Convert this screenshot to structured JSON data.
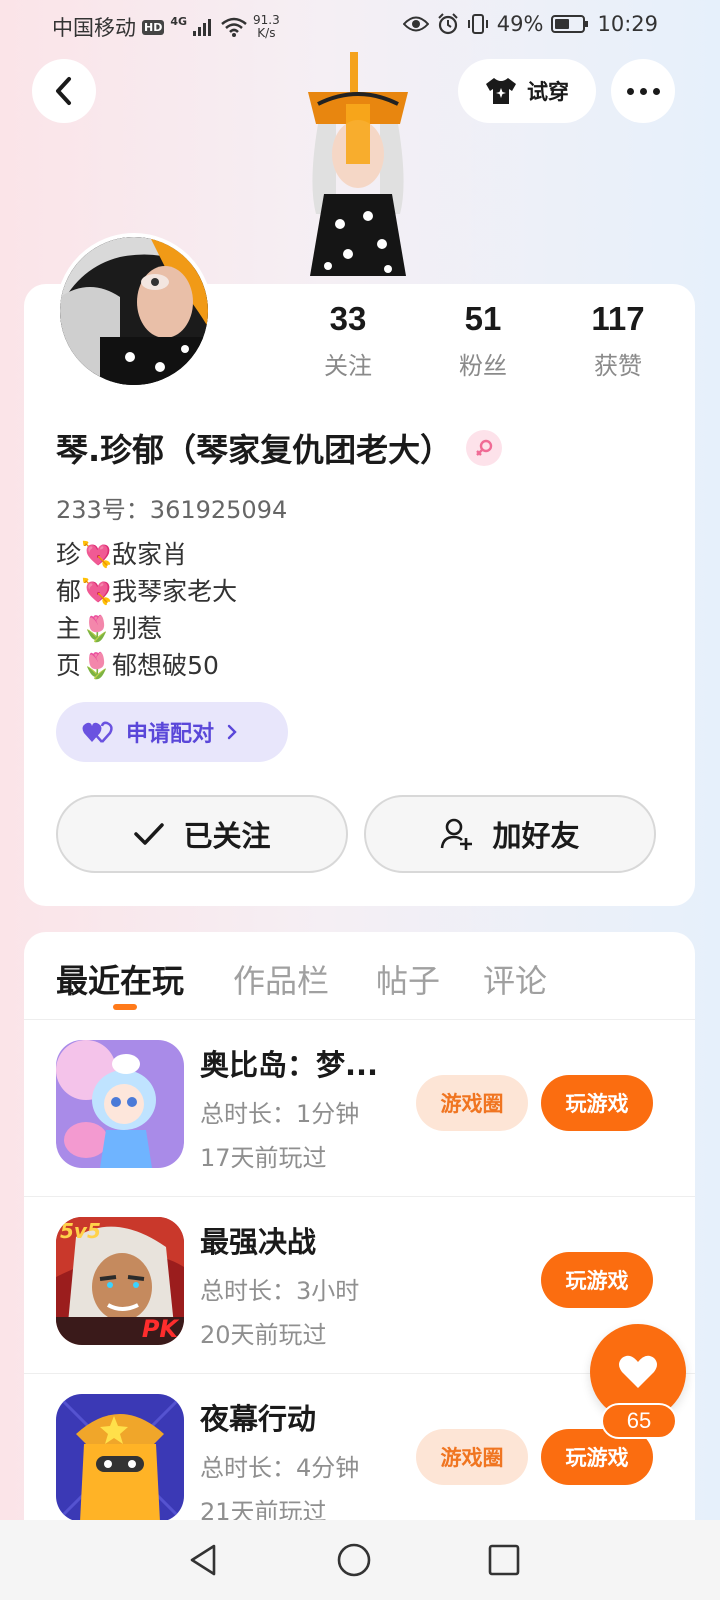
{
  "status_bar": {
    "carrier": "中国移动",
    "hd_badge": "HD",
    "network": "4G",
    "speed_value": "91.3",
    "speed_unit": "K/s",
    "battery": "49%",
    "time": "10:29"
  },
  "header": {
    "try_on_label": "试穿"
  },
  "profile": {
    "stats": [
      {
        "value": "33",
        "label": "关注"
      },
      {
        "value": "51",
        "label": "粉丝"
      },
      {
        "value": "117",
        "label": "获赞"
      }
    ],
    "name": "琴.珍郁（琴家复仇团老大）",
    "id_line": "233号：361925094",
    "bio": [
      "珍💘敌家肖",
      "郁💘我琴家老大",
      "主🌷别惹",
      "页🌷郁想破50"
    ],
    "pair_button": "申请配对",
    "follow_button": "已关注",
    "add_friend_button": "加好友"
  },
  "tabs": [
    "最近在玩",
    "作品栏",
    "帖子",
    "评论"
  ],
  "games": [
    {
      "title": "奥比岛：梦...",
      "duration": "总时长：1分钟",
      "last_played": "17天前玩过",
      "circle_label": "游戏圈",
      "play_label": "玩游戏"
    },
    {
      "title": "最强决战",
      "duration": "总时长：3小时",
      "last_played": "20天前玩过",
      "play_label": "玩游戏"
    },
    {
      "title": "夜幕行动",
      "duration": "总时长：4分钟",
      "last_played": "21天前玩过",
      "circle_label": "游戏圈",
      "play_label": "玩游戏"
    }
  ],
  "game_badge": {
    "game2_tag": "5v5",
    "game2_pk": "PK"
  },
  "like_count": "65",
  "colors": {
    "accent": "#fb6d10",
    "pair_bg": "#e8e6fb",
    "pair_text": "#5a47d9"
  }
}
